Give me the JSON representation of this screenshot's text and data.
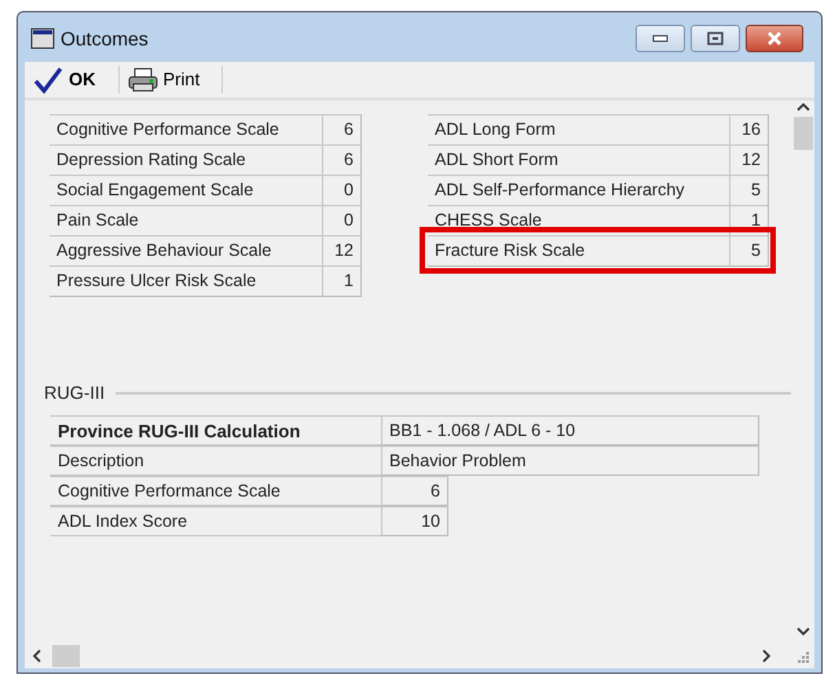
{
  "window": {
    "title": "Outcomes"
  },
  "toolbar": [
    {
      "kind": "ok",
      "label": "OK"
    },
    {
      "kind": "print",
      "label": "Print"
    }
  ],
  "scores_left": [
    {
      "label": "Cognitive Performance Scale",
      "value": "6",
      "highlighted": false
    },
    {
      "label": "Depression Rating Scale",
      "value": "6",
      "highlighted": false
    },
    {
      "label": "Social Engagement Scale",
      "value": "0",
      "highlighted": false
    },
    {
      "label": "Pain Scale",
      "value": "0",
      "highlighted": false
    },
    {
      "label": "Aggressive Behaviour Scale",
      "value": "12",
      "highlighted": false
    },
    {
      "label": "Pressure Ulcer Risk Scale",
      "value": "1",
      "highlighted": false
    }
  ],
  "scores_right": [
    {
      "label": "ADL Long Form",
      "value": "16",
      "highlighted": false
    },
    {
      "label": "ADL Short Form",
      "value": "12",
      "highlighted": false
    },
    {
      "label": "ADL Self-Performance Hierarchy",
      "value": "5",
      "highlighted": false
    },
    {
      "label": "CHESS Scale",
      "value": "1",
      "highlighted": false
    },
    {
      "label": "Fracture Risk Scale",
      "value": "5",
      "highlighted": true
    }
  ],
  "rug": {
    "title": "RUG-III",
    "rows": [
      {
        "kind": "header",
        "label": "Province RUG-III Calculation",
        "value": "BB1 - 1.068 / ADL 6 - 10"
      },
      {
        "kind": "wide",
        "label": "Description",
        "value": "Behavior Problem"
      },
      {
        "kind": "number",
        "label": "Cognitive Performance Scale",
        "value": "6"
      },
      {
        "kind": "number",
        "label": "ADL Index Score",
        "value": "10"
      }
    ]
  }
}
